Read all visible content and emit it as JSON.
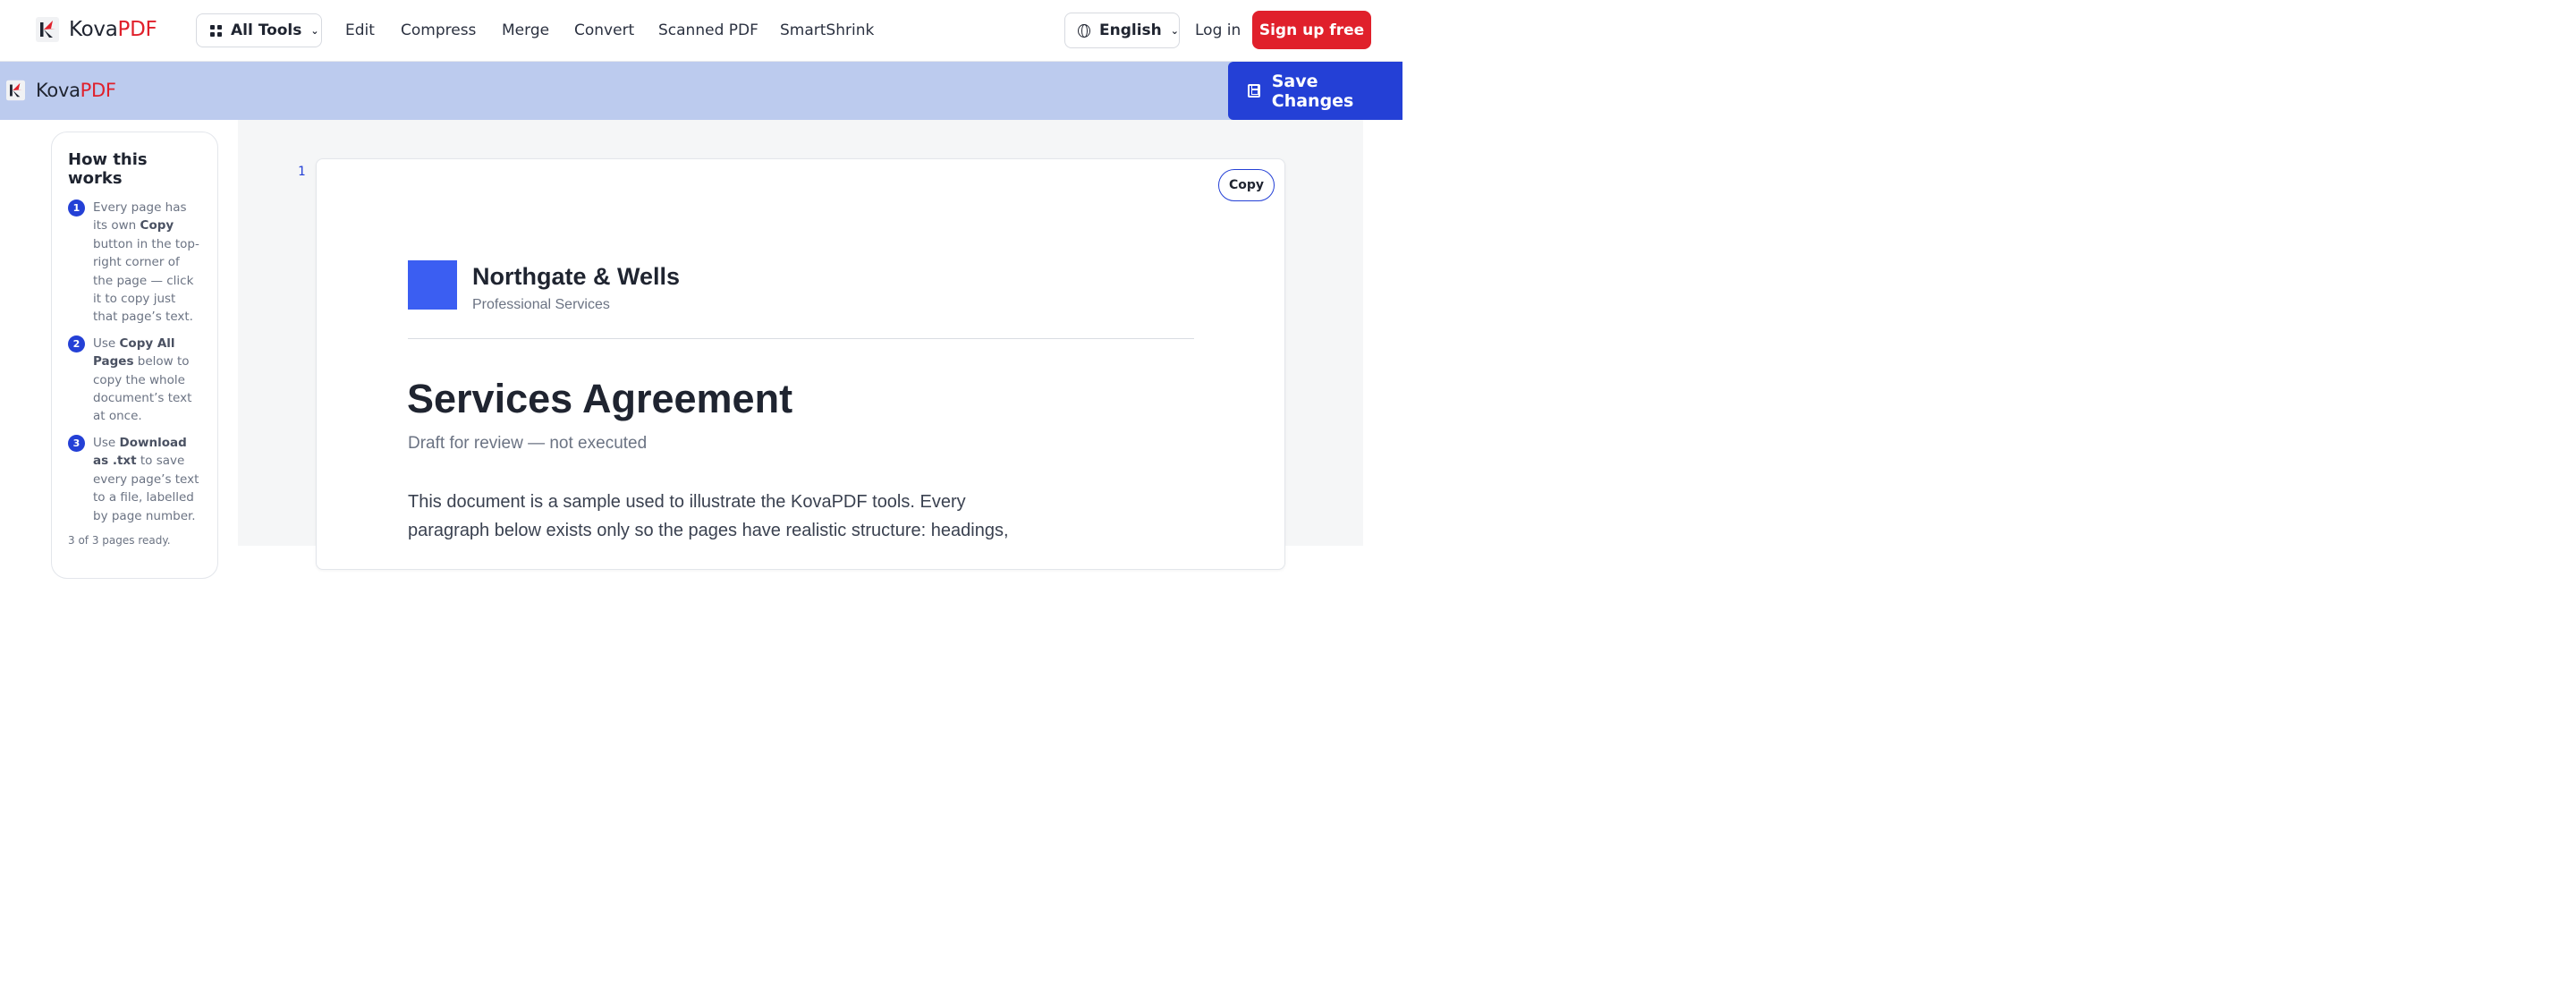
{
  "topnav": {
    "brand_main": "Kova",
    "brand_accent": "PDF",
    "all_tools_label": "All Tools",
    "links": [
      "Edit",
      "Compress",
      "Merge",
      "Convert",
      "Scanned PDF",
      "SmartShrink"
    ],
    "language_label": "English",
    "login_label": "Log in",
    "signup_label": "Sign up free"
  },
  "editorbar": {
    "brand_main": "Kova",
    "brand_accent": "PDF",
    "save_label": "Save Changes"
  },
  "howto": {
    "title": "How this works",
    "steps": [
      {
        "num": "1",
        "pre": "Every page has its own ",
        "bold": "Copy",
        "post": " button in the top-right corner of the page — click it to copy just that page’s text."
      },
      {
        "num": "2",
        "pre": "Use ",
        "bold": "Copy All Pages",
        "post": " below to copy the whole document’s text at once."
      },
      {
        "num": "3",
        "pre": "Use ",
        "bold": "Download as .txt",
        "post": " to save every page’s text to a file, labelled by page number."
      }
    ],
    "status": "3 of 3 pages ready."
  },
  "page": {
    "number": "1",
    "copy_label": "Copy",
    "company_name": "Northgate & Wells",
    "company_tagline": "Professional Services",
    "title": "Services Agreement",
    "subtitle": "Draft for review — not executed",
    "body": "This document is a sample used to illustrate the KovaPDF tools. Every paragraph below exists only so the pages have realistic structure: headings,"
  },
  "colors": {
    "brand_red": "#e0202b",
    "accent_blue": "#2440d6",
    "editor_bar": "#bccbee",
    "logo_square": "#3b5ef2"
  },
  "icons": [
    "kovapdf-logo-icon",
    "grid-icon",
    "chevron-down-icon",
    "globe-icon",
    "save-icon"
  ]
}
